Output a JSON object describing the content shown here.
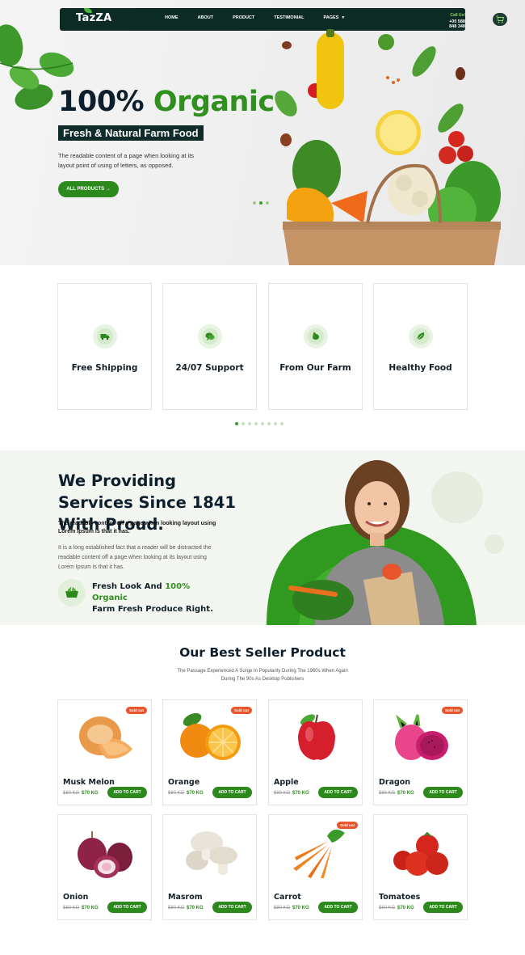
{
  "nav": {
    "logo": "TazZA",
    "links": [
      "HOME",
      "ABOUT",
      "PRODUCT",
      "TESTIMONIAL",
      "PAGES"
    ],
    "call_label": "Call Us!",
    "phone": "+00 588 848 348"
  },
  "hero": {
    "title_part1": "100%",
    "title_part2": "Organic",
    "subtitle": "Fresh & Natural Farm Food",
    "description": "The readable content of a page when looking at its layout point of using of letters, as opposed.",
    "button": "ALL PRODUCTS →"
  },
  "features": [
    {
      "label": "Free Shipping",
      "icon": "truck-icon"
    },
    {
      "label": "24/07 Support",
      "icon": "support-chat-icon"
    },
    {
      "label": "From Our Farm",
      "icon": "rooster-icon"
    },
    {
      "label": "Healthy Food",
      "icon": "leaf-icon"
    }
  ],
  "services": {
    "title": "We Providing Services Since 1841 With Proud.",
    "bold_text": "The readable content off a page when looking layout using Lorem Ipsum is that it has.",
    "body_text": "It is a long established fact that a reader will be distracted the readable content off a page when looking at its layout using Lorem Ipsum is that it has.",
    "badge_part1": "Fresh Look And",
    "badge_highlight": "100% Organic",
    "badge_part2": "Farm Fresh Produce Right."
  },
  "products": {
    "heading": "Our Best Seller Product",
    "description": "The Passage Experienced A Surge In Popularity During The 1960s When Again During The 90s As Desktop Publishers",
    "sold_label": "Sold out",
    "cart_label": "ADD TO CART",
    "items": [
      {
        "name": "Musk Melon",
        "old_price": "$80 KG",
        "price": "$70 KG",
        "sold": true
      },
      {
        "name": "Orange",
        "old_price": "$80 KG",
        "price": "$70 KG",
        "sold": true
      },
      {
        "name": "Apple",
        "old_price": "$80 KG",
        "price": "$70 KG",
        "sold": false
      },
      {
        "name": "Dragon",
        "old_price": "$80 KG",
        "price": "$70 KG",
        "sold": true
      },
      {
        "name": "Onion",
        "old_price": "$80 KG",
        "price": "$70 KG",
        "sold": false
      },
      {
        "name": "Masrom",
        "old_price": "$80 KG",
        "price": "$70 KG",
        "sold": false
      },
      {
        "name": "Carrot",
        "old_price": "$80 KG",
        "price": "$70 KG",
        "sold": true
      },
      {
        "name": "Tomatoes",
        "old_price": "$80 KG",
        "price": "$70 KG",
        "sold": false
      }
    ]
  },
  "colors": {
    "brand_green": "#2c8a1d",
    "dark_nav": "#0d2b25",
    "sold_badge": "#e9542b"
  }
}
